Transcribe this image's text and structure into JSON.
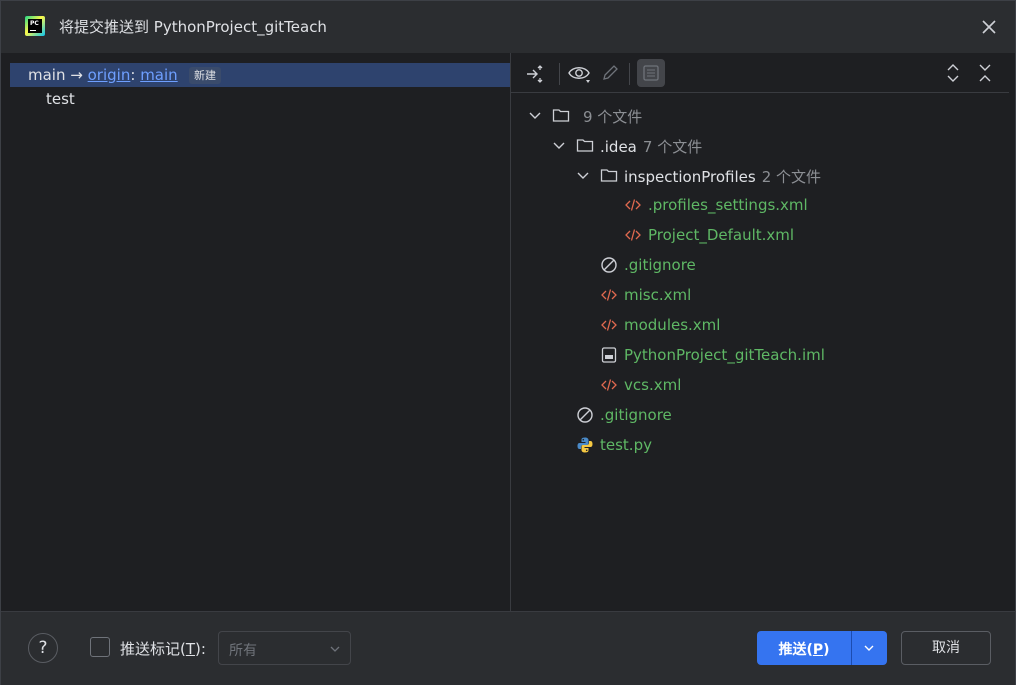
{
  "window": {
    "title": "将提交推送到 PythonProject_gitTeach",
    "app_icon": "pycharm-logo",
    "app_icon_text": "PC"
  },
  "left": {
    "branch": {
      "local": "main",
      "arrow": "→",
      "remote": "origin",
      "separator": ":",
      "remote_branch": "main",
      "badge": "新建"
    },
    "commits": [
      "test"
    ]
  },
  "toolbar": {
    "icons": [
      "expand-collapse-icon",
      "eye-icon",
      "pencil-icon",
      "diff-panel-icon",
      "expand-all-icon",
      "collapse-all-icon"
    ]
  },
  "tree": {
    "root": {
      "label": "",
      "count": "9 个文件"
    },
    "idea": {
      "label": ".idea",
      "count": "7 个文件"
    },
    "inspection": {
      "label": "inspectionProfiles",
      "count": "2 个文件"
    },
    "files": {
      "profiles_settings": ".profiles_settings.xml",
      "project_default": "Project_Default.xml",
      "idea_gitignore": ".gitignore",
      "misc": "misc.xml",
      "modules": "modules.xml",
      "iml": "PythonProject_gitTeach.iml",
      "vcs": "vcs.xml",
      "root_gitignore": ".gitignore",
      "testpy": "test.py"
    }
  },
  "bottom": {
    "help": "?",
    "push_tags_label": "推送标记(",
    "push_tags_mnemonic": "T",
    "push_tags_suffix": "):",
    "tags_select_value": "所有",
    "push_label": "推送(",
    "push_mnemonic": "P",
    "push_suffix": ")",
    "cancel": "取消"
  },
  "colors": {
    "accent": "#3574f0",
    "selection": "#2e436e",
    "added_file": "#5fb865",
    "link": "#6e9fff"
  }
}
